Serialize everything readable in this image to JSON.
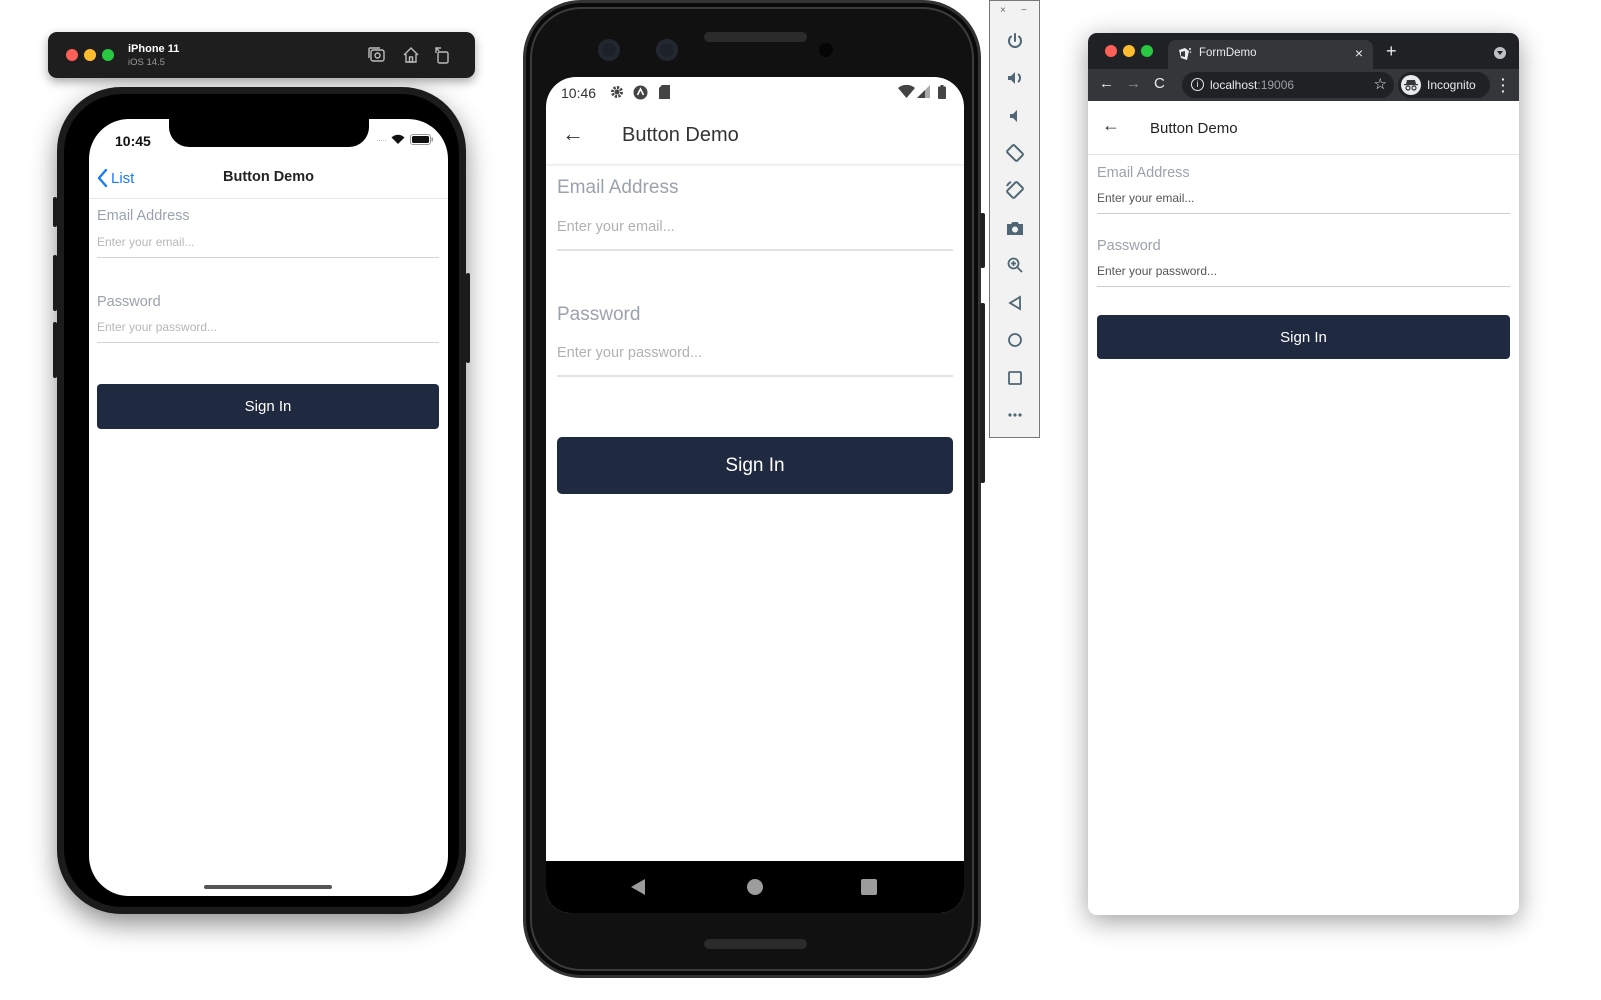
{
  "colors": {
    "button_bg": "#1f2a40",
    "button_text": "#ffffff",
    "label": "#9aa3ad",
    "ios_link": "#1a7cf5",
    "traffic_red": "#fe5f57",
    "traffic_yellow": "#febc2e",
    "traffic_green": "#28c840"
  },
  "ios_simulator": {
    "device_name": "iPhone 11",
    "os_version": "iOS 14.5",
    "toolbar_icons": [
      "screenshot-icon",
      "home-icon",
      "rotate-icon"
    ],
    "status_time": "10:45",
    "nav_back_label": "List",
    "nav_title": "Button Demo",
    "email_label": "Email Address",
    "email_placeholder": "Enter your email...",
    "password_label": "Password",
    "password_placeholder": "Enter your password...",
    "sign_in_label": "Sign In"
  },
  "android_emulator": {
    "status_time": "10:46",
    "status_icons": [
      "gear-icon",
      "a-badge-icon",
      "sd-card-icon",
      "wifi-icon",
      "signal-icon",
      "battery-icon"
    ],
    "appbar_back": "←",
    "appbar_title": "Button Demo",
    "email_label": "Email Address",
    "email_placeholder": "Enter your email...",
    "password_label": "Password",
    "password_placeholder": "Enter your password...",
    "sign_in_label": "Sign In",
    "nav_buttons": [
      "back",
      "home",
      "recents"
    ]
  },
  "emulator_toolbar": {
    "close": "×",
    "minimize": "−",
    "tools": [
      "power",
      "volume-up",
      "volume-down",
      "rotate-left",
      "rotate-right",
      "camera",
      "zoom",
      "back",
      "home",
      "overview",
      "more"
    ]
  },
  "chrome": {
    "tab_title": "FormDemo",
    "tab_close": "×",
    "new_tab": "+",
    "url_host": "localhost",
    "url_port": ":19006",
    "profile_label": "Incognito",
    "page": {
      "back": "←",
      "title": "Button Demo",
      "email_label": "Email Address",
      "email_placeholder": "Enter your email...",
      "password_label": "Password",
      "password_placeholder": "Enter your password...",
      "sign_in_label": "Sign In"
    }
  }
}
